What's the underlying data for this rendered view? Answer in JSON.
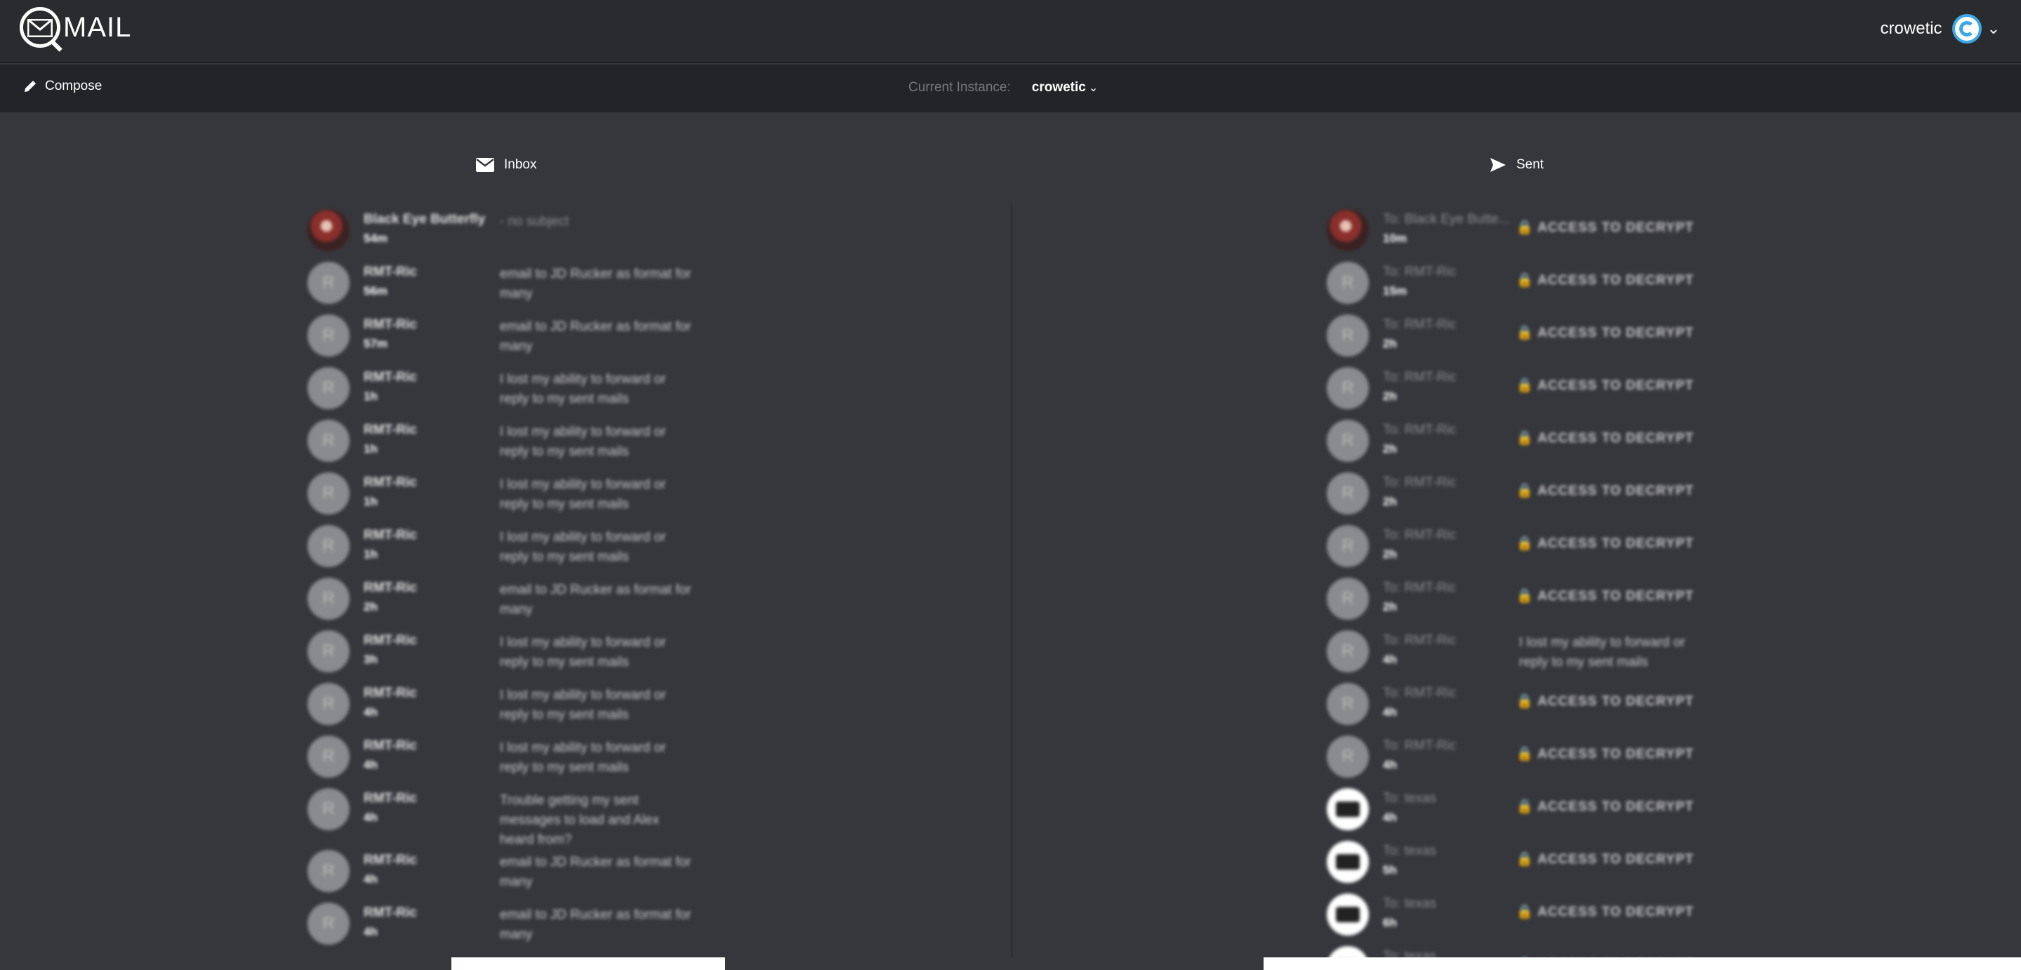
{
  "app": {
    "name": "MAIL"
  },
  "user": {
    "name": "crowetic"
  },
  "toolbar": {
    "compose_label": "Compose",
    "instance_label": "Current Instance:",
    "instance_value": "crowetic"
  },
  "inbox": {
    "title": "Inbox",
    "items": [
      {
        "from": "Black Eye Butterfly",
        "time": "54m",
        "subject": "- no subject",
        "avatar": "photo"
      },
      {
        "from": "RMT-Ric",
        "time": "56m",
        "subject": "email to JD Rucker as format for many",
        "avatar": "R"
      },
      {
        "from": "RMT-Ric",
        "time": "57m",
        "subject": "email to JD Rucker as format for many",
        "avatar": "R"
      },
      {
        "from": "RMT-Ric",
        "time": "1h",
        "subject": "I lost my ability to forward or reply to my sent mails",
        "avatar": "R"
      },
      {
        "from": "RMT-Ric",
        "time": "1h",
        "subject": "I lost my ability to forward or reply to my sent mails",
        "avatar": "R"
      },
      {
        "from": "RMT-Ric",
        "time": "1h",
        "subject": "I lost my ability to forward or reply to my sent mails",
        "avatar": "R"
      },
      {
        "from": "RMT-Ric",
        "time": "1h",
        "subject": "I lost my ability to forward or reply to my sent mails",
        "avatar": "R"
      },
      {
        "from": "RMT-Ric",
        "time": "2h",
        "subject": "email to JD Rucker as format for many",
        "avatar": "R"
      },
      {
        "from": "RMT-Ric",
        "time": "3h",
        "subject": "I lost my ability to forward or reply to my sent mails",
        "avatar": "R"
      },
      {
        "from": "RMT-Ric",
        "time": "4h",
        "subject": "I lost my ability to forward or reply to my sent mails",
        "avatar": "R"
      },
      {
        "from": "RMT-Ric",
        "time": "4h",
        "subject": "I lost my ability to forward or reply to my sent mails",
        "avatar": "R"
      },
      {
        "from": "RMT-Ric",
        "time": "4h",
        "subject": "Trouble getting my sent messages to load and Alex heard from?",
        "avatar": "R"
      },
      {
        "from": "RMT-Ric",
        "time": "4h",
        "subject": "email to JD Rucker as format for many",
        "avatar": "R"
      },
      {
        "from": "RMT-Ric",
        "time": "4h",
        "subject": "email to JD Rucker as format for many",
        "avatar": "R"
      }
    ]
  },
  "sent": {
    "title": "Sent",
    "items": [
      {
        "to": "To: Black Eye Butte...",
        "time": "10m",
        "subject": "ACCESS TO DECRYPT",
        "locked": true,
        "avatar": "photo"
      },
      {
        "to": "To: RMT-Ric",
        "time": "15m",
        "subject": "ACCESS TO DECRYPT",
        "locked": true,
        "avatar": "R"
      },
      {
        "to": "To: RMT-Ric",
        "time": "2h",
        "subject": "ACCESS TO DECRYPT",
        "locked": true,
        "avatar": "R"
      },
      {
        "to": "To: RMT-Ric",
        "time": "2h",
        "subject": "ACCESS TO DECRYPT",
        "locked": true,
        "avatar": "R"
      },
      {
        "to": "To: RMT-Ric",
        "time": "2h",
        "subject": "ACCESS TO DECRYPT",
        "locked": true,
        "avatar": "R"
      },
      {
        "to": "To: RMT-Ric",
        "time": "2h",
        "subject": "ACCESS TO DECRYPT",
        "locked": true,
        "avatar": "R"
      },
      {
        "to": "To: RMT-Ric",
        "time": "2h",
        "subject": "ACCESS TO DECRYPT",
        "locked": true,
        "avatar": "R"
      },
      {
        "to": "To: RMT-Ric",
        "time": "2h",
        "subject": "ACCESS TO DECRYPT",
        "locked": true,
        "avatar": "R"
      },
      {
        "to": "To: RMT-Ric",
        "time": "4h",
        "subject": "I lost my ability to forward or reply to my sent mails",
        "locked": false,
        "avatar": "R"
      },
      {
        "to": "To: RMT-Ric",
        "time": "4h",
        "subject": "ACCESS TO DECRYPT",
        "locked": true,
        "avatar": "R"
      },
      {
        "to": "To: RMT-Ric",
        "time": "4h",
        "subject": "ACCESS TO DECRYPT",
        "locked": true,
        "avatar": "R"
      },
      {
        "to": "To: texas",
        "time": "4h",
        "subject": "ACCESS TO DECRYPT",
        "locked": true,
        "avatar": "white"
      },
      {
        "to": "To: texas",
        "time": "5h",
        "subject": "ACCESS TO DECRYPT",
        "locked": true,
        "avatar": "white"
      },
      {
        "to": "To: texas",
        "time": "6h",
        "subject": "ACCESS TO DECRYPT",
        "locked": true,
        "avatar": "white"
      },
      {
        "to": "To: texas",
        "time": "",
        "subject": "ACCESS TO DECRYPT",
        "locked": true,
        "avatar": "white"
      }
    ]
  }
}
